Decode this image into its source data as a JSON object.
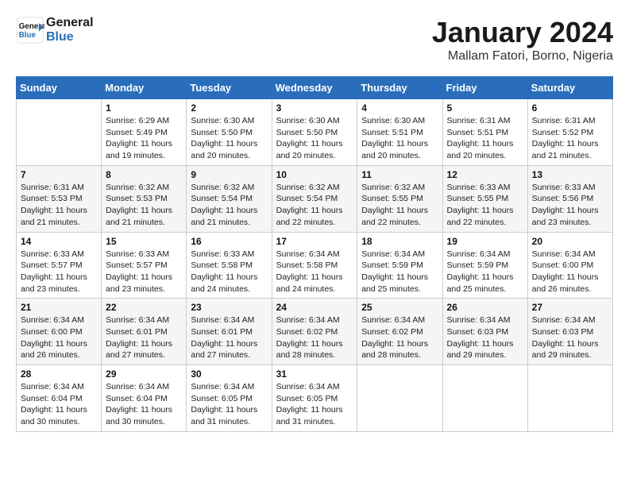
{
  "header": {
    "logo_line1": "General",
    "logo_line2": "Blue",
    "month_title": "January 2024",
    "subtitle": "Mallam Fatori, Borno, Nigeria"
  },
  "weekdays": [
    "Sunday",
    "Monday",
    "Tuesday",
    "Wednesday",
    "Thursday",
    "Friday",
    "Saturday"
  ],
  "weeks": [
    [
      {
        "day": "",
        "sunrise": "",
        "sunset": "",
        "daylight": ""
      },
      {
        "day": "1",
        "sunrise": "Sunrise: 6:29 AM",
        "sunset": "Sunset: 5:49 PM",
        "daylight": "Daylight: 11 hours and 19 minutes."
      },
      {
        "day": "2",
        "sunrise": "Sunrise: 6:30 AM",
        "sunset": "Sunset: 5:50 PM",
        "daylight": "Daylight: 11 hours and 20 minutes."
      },
      {
        "day": "3",
        "sunrise": "Sunrise: 6:30 AM",
        "sunset": "Sunset: 5:50 PM",
        "daylight": "Daylight: 11 hours and 20 minutes."
      },
      {
        "day": "4",
        "sunrise": "Sunrise: 6:30 AM",
        "sunset": "Sunset: 5:51 PM",
        "daylight": "Daylight: 11 hours and 20 minutes."
      },
      {
        "day": "5",
        "sunrise": "Sunrise: 6:31 AM",
        "sunset": "Sunset: 5:51 PM",
        "daylight": "Daylight: 11 hours and 20 minutes."
      },
      {
        "day": "6",
        "sunrise": "Sunrise: 6:31 AM",
        "sunset": "Sunset: 5:52 PM",
        "daylight": "Daylight: 11 hours and 21 minutes."
      }
    ],
    [
      {
        "day": "7",
        "sunrise": "Sunrise: 6:31 AM",
        "sunset": "Sunset: 5:53 PM",
        "daylight": "Daylight: 11 hours and 21 minutes."
      },
      {
        "day": "8",
        "sunrise": "Sunrise: 6:32 AM",
        "sunset": "Sunset: 5:53 PM",
        "daylight": "Daylight: 11 hours and 21 minutes."
      },
      {
        "day": "9",
        "sunrise": "Sunrise: 6:32 AM",
        "sunset": "Sunset: 5:54 PM",
        "daylight": "Daylight: 11 hours and 21 minutes."
      },
      {
        "day": "10",
        "sunrise": "Sunrise: 6:32 AM",
        "sunset": "Sunset: 5:54 PM",
        "daylight": "Daylight: 11 hours and 22 minutes."
      },
      {
        "day": "11",
        "sunrise": "Sunrise: 6:32 AM",
        "sunset": "Sunset: 5:55 PM",
        "daylight": "Daylight: 11 hours and 22 minutes."
      },
      {
        "day": "12",
        "sunrise": "Sunrise: 6:33 AM",
        "sunset": "Sunset: 5:55 PM",
        "daylight": "Daylight: 11 hours and 22 minutes."
      },
      {
        "day": "13",
        "sunrise": "Sunrise: 6:33 AM",
        "sunset": "Sunset: 5:56 PM",
        "daylight": "Daylight: 11 hours and 23 minutes."
      }
    ],
    [
      {
        "day": "14",
        "sunrise": "Sunrise: 6:33 AM",
        "sunset": "Sunset: 5:57 PM",
        "daylight": "Daylight: 11 hours and 23 minutes."
      },
      {
        "day": "15",
        "sunrise": "Sunrise: 6:33 AM",
        "sunset": "Sunset: 5:57 PM",
        "daylight": "Daylight: 11 hours and 23 minutes."
      },
      {
        "day": "16",
        "sunrise": "Sunrise: 6:33 AM",
        "sunset": "Sunset: 5:58 PM",
        "daylight": "Daylight: 11 hours and 24 minutes."
      },
      {
        "day": "17",
        "sunrise": "Sunrise: 6:34 AM",
        "sunset": "Sunset: 5:58 PM",
        "daylight": "Daylight: 11 hours and 24 minutes."
      },
      {
        "day": "18",
        "sunrise": "Sunrise: 6:34 AM",
        "sunset": "Sunset: 5:59 PM",
        "daylight": "Daylight: 11 hours and 25 minutes."
      },
      {
        "day": "19",
        "sunrise": "Sunrise: 6:34 AM",
        "sunset": "Sunset: 5:59 PM",
        "daylight": "Daylight: 11 hours and 25 minutes."
      },
      {
        "day": "20",
        "sunrise": "Sunrise: 6:34 AM",
        "sunset": "Sunset: 6:00 PM",
        "daylight": "Daylight: 11 hours and 26 minutes."
      }
    ],
    [
      {
        "day": "21",
        "sunrise": "Sunrise: 6:34 AM",
        "sunset": "Sunset: 6:00 PM",
        "daylight": "Daylight: 11 hours and 26 minutes."
      },
      {
        "day": "22",
        "sunrise": "Sunrise: 6:34 AM",
        "sunset": "Sunset: 6:01 PM",
        "daylight": "Daylight: 11 hours and 27 minutes."
      },
      {
        "day": "23",
        "sunrise": "Sunrise: 6:34 AM",
        "sunset": "Sunset: 6:01 PM",
        "daylight": "Daylight: 11 hours and 27 minutes."
      },
      {
        "day": "24",
        "sunrise": "Sunrise: 6:34 AM",
        "sunset": "Sunset: 6:02 PM",
        "daylight": "Daylight: 11 hours and 28 minutes."
      },
      {
        "day": "25",
        "sunrise": "Sunrise: 6:34 AM",
        "sunset": "Sunset: 6:02 PM",
        "daylight": "Daylight: 11 hours and 28 minutes."
      },
      {
        "day": "26",
        "sunrise": "Sunrise: 6:34 AM",
        "sunset": "Sunset: 6:03 PM",
        "daylight": "Daylight: 11 hours and 29 minutes."
      },
      {
        "day": "27",
        "sunrise": "Sunrise: 6:34 AM",
        "sunset": "Sunset: 6:03 PM",
        "daylight": "Daylight: 11 hours and 29 minutes."
      }
    ],
    [
      {
        "day": "28",
        "sunrise": "Sunrise: 6:34 AM",
        "sunset": "Sunset: 6:04 PM",
        "daylight": "Daylight: 11 hours and 30 minutes."
      },
      {
        "day": "29",
        "sunrise": "Sunrise: 6:34 AM",
        "sunset": "Sunset: 6:04 PM",
        "daylight": "Daylight: 11 hours and 30 minutes."
      },
      {
        "day": "30",
        "sunrise": "Sunrise: 6:34 AM",
        "sunset": "Sunset: 6:05 PM",
        "daylight": "Daylight: 11 hours and 31 minutes."
      },
      {
        "day": "31",
        "sunrise": "Sunrise: 6:34 AM",
        "sunset": "Sunset: 6:05 PM",
        "daylight": "Daylight: 11 hours and 31 minutes."
      },
      {
        "day": "",
        "sunrise": "",
        "sunset": "",
        "daylight": ""
      },
      {
        "day": "",
        "sunrise": "",
        "sunset": "",
        "daylight": ""
      },
      {
        "day": "",
        "sunrise": "",
        "sunset": "",
        "daylight": ""
      }
    ]
  ]
}
